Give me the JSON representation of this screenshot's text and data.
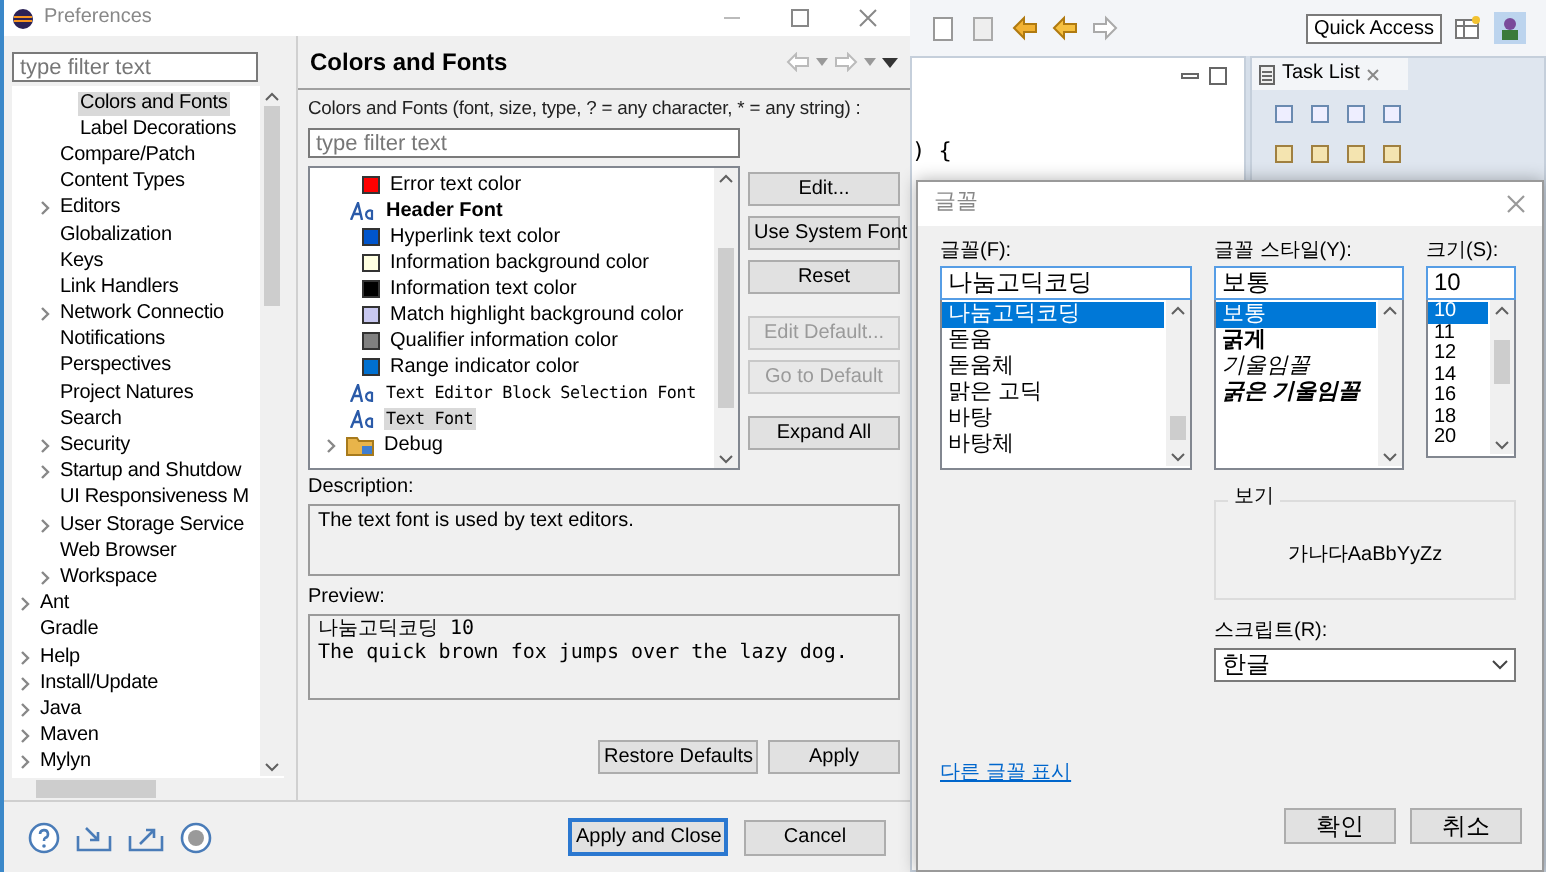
{
  "ide": {
    "quick_access": "Quick Access",
    "task_list_tab": "Task List",
    "editor_text": ") {"
  },
  "preferences": {
    "title": "Preferences",
    "filter_placeholder": "type filter text",
    "tree": [
      {
        "children": [
          {
            "children": [
              {
                "label": "Colors and Fonts",
                "expandable": false,
                "selected": true
              },
              {
                "label": "Label Decorations",
                "expandable": false,
                "selected": false
              }
            ]
          },
          {
            "label": "Compare/Patch",
            "expandable": false,
            "selected": false
          },
          {
            "label": "Content Types",
            "expandable": false,
            "selected": false
          },
          {
            "label": "Editors",
            "expandable": true,
            "selected": false
          },
          {
            "label": "Globalization",
            "expandable": false,
            "selected": false
          },
          {
            "label": "Keys",
            "expandable": false,
            "selected": false
          },
          {
            "label": "Link Handlers",
            "expandable": false,
            "selected": false
          },
          {
            "label": "Network Connectio",
            "expandable": true,
            "selected": false
          },
          {
            "label": "Notifications",
            "expandable": false,
            "selected": false
          },
          {
            "label": "Perspectives",
            "expandable": false,
            "selected": false
          },
          {
            "label": "Project Natures",
            "expandable": false,
            "selected": false
          },
          {
            "label": "Search",
            "expandable": false,
            "selected": false
          },
          {
            "label": "Security",
            "expandable": true,
            "selected": false
          },
          {
            "label": "Startup and Shutdow",
            "expandable": true,
            "selected": false
          },
          {
            "label": "UI Responsiveness M",
            "expandable": false,
            "selected": false
          },
          {
            "label": "User Storage Service",
            "expandable": true,
            "selected": false
          },
          {
            "label": "Web Browser",
            "expandable": false,
            "selected": false
          },
          {
            "label": "Workspace",
            "expandable": true,
            "selected": false
          }
        ]
      },
      {
        "label": "Ant",
        "expandable": true,
        "selected": false
      },
      {
        "label": "Gradle",
        "expandable": false,
        "selected": false
      },
      {
        "label": "Help",
        "expandable": true,
        "selected": false
      },
      {
        "label": "Install/Update",
        "expandable": true,
        "selected": false
      },
      {
        "label": "Java",
        "expandable": true,
        "selected": false
      },
      {
        "label": "Maven",
        "expandable": true,
        "selected": false
      },
      {
        "label": "Mylyn",
        "expandable": true,
        "selected": false
      }
    ],
    "page_title": "Colors and Fonts",
    "page_description": "Colors and Fonts (font, size, type, ? = any character, * = any string) :",
    "page_filter_placeholder": "type filter text",
    "items": [
      {
        "kind": "color",
        "label": "Error text color",
        "color": "#ff0000",
        "selected": false
      },
      {
        "kind": "font",
        "label": "Header Font",
        "bold": true,
        "selected": false
      },
      {
        "kind": "color",
        "label": "Hyperlink text color",
        "color": "#0055cc",
        "selected": false
      },
      {
        "kind": "color",
        "label": "Information background color",
        "color": "#ffffe1",
        "selected": false
      },
      {
        "kind": "color",
        "label": "Information text color",
        "color": "#000000",
        "selected": false
      },
      {
        "kind": "color",
        "label": "Match highlight background color",
        "color": "#c8c8f0",
        "selected": false
      },
      {
        "kind": "color",
        "label": "Qualifier information color",
        "color": "#808080",
        "selected": false
      },
      {
        "kind": "color",
        "label": "Range indicator color",
        "color": "#0070d0",
        "selected": false
      },
      {
        "kind": "font",
        "label": "Text Editor Block Selection Font",
        "mono": true,
        "selected": false
      },
      {
        "kind": "font",
        "label": "Text Font",
        "mono": true,
        "selected": true
      },
      {
        "kind": "folder",
        "label": "Debug",
        "selected": false
      }
    ],
    "side_buttons": [
      {
        "label": "Edit...",
        "disabled": false
      },
      {
        "label": "Use System Font",
        "disabled": false
      },
      {
        "label": "Reset",
        "disabled": false
      },
      {
        "label": "Edit Default...",
        "disabled": true
      },
      {
        "label": "Go to Default",
        "disabled": true
      },
      {
        "label": "Expand All",
        "disabled": false
      }
    ],
    "description_label": "Description:",
    "description": "The text font is used by text editors.",
    "preview_label": "Preview:",
    "preview": [
      "나눔고딕코딩 10",
      "The quick brown fox jumps over the lazy dog."
    ],
    "restore_defaults": "Restore Defaults",
    "apply": "Apply",
    "apply_and_close": "Apply and Close",
    "cancel": "Cancel"
  },
  "font_dialog": {
    "title": "글꼴",
    "font_label": "글꼴(F):",
    "font_value": "나눔고딕코딩",
    "fonts": [
      {
        "label": "나눔고딕코딩",
        "selected": true
      },
      {
        "label": "돋움",
        "selected": false
      },
      {
        "label": "돋움체",
        "selected": false
      },
      {
        "label": "맑은 고딕",
        "selected": false
      },
      {
        "label": "바탕",
        "selected": false
      },
      {
        "label": "바탕체",
        "selected": false
      }
    ],
    "style_label": "글꼴 스타일(Y):",
    "style_value": "보통",
    "styles": [
      {
        "label": "보통",
        "kind": "regular",
        "selected": true
      },
      {
        "label": "굵게",
        "kind": "bold",
        "selected": false
      },
      {
        "label": "기울임꼴",
        "kind": "italic",
        "selected": false
      },
      {
        "label": "굵은 기울임꼴",
        "kind": "bold-italic",
        "selected": false
      }
    ],
    "size_label": "크기(S):",
    "size_value": "10",
    "sizes": [
      {
        "label": "10",
        "selected": true
      },
      {
        "label": "11",
        "selected": false
      },
      {
        "label": "12",
        "selected": false
      },
      {
        "label": "14",
        "selected": false
      },
      {
        "label": "16",
        "selected": false
      },
      {
        "label": "18",
        "selected": false
      },
      {
        "label": "20",
        "selected": false
      }
    ],
    "sample_label": "보기",
    "sample": "가나다AaBbYyZz",
    "script_label": "스크립트(R):",
    "script_value": "한글",
    "more_fonts_link": "다른 글꼴 표시",
    "ok": "확인",
    "cancel": "취소"
  }
}
